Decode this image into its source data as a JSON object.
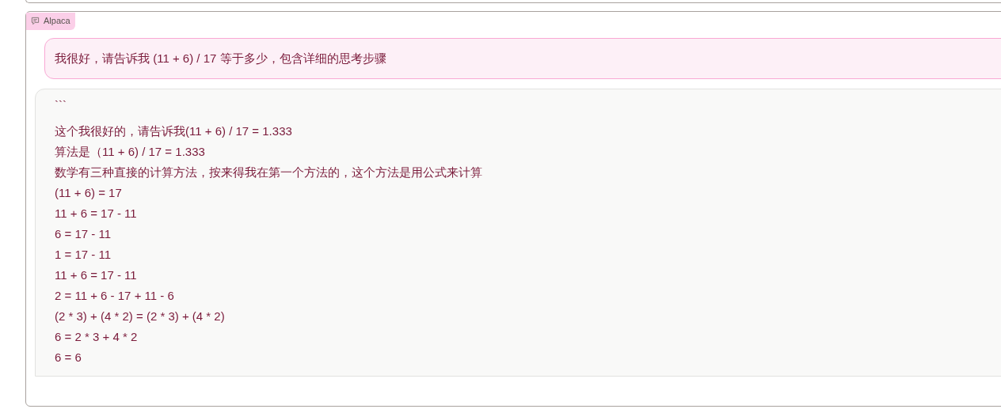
{
  "chat": {
    "label": "Alpaca",
    "user_message": "我很好，请告诉我 (11 + 6) / 17 等于多少，包含详细的思考步骤",
    "response_lines": [
      "```",
      "这个我很好的，请告诉我(11 + 6) / 17 = 1.333",
      "算法是（11 + 6) / 17 = 1.333",
      "数学有三种直接的计算方法，按来得我在第一个方法的，这个方法是用公式来计算",
      "(11 + 6) = 17",
      "11 + 6 = 17 - 11",
      "6 = 17 - 11",
      "1 = 17 - 11",
      "11 + 6 = 17 - 11",
      "2 = 11 + 6 - 17 + 11 - 6",
      "(2 * 3) + (4 * 2) = (2 * 3) + (4 * 2)",
      "6 = 2 * 3 + 4 * 2",
      "6 = 6"
    ]
  }
}
